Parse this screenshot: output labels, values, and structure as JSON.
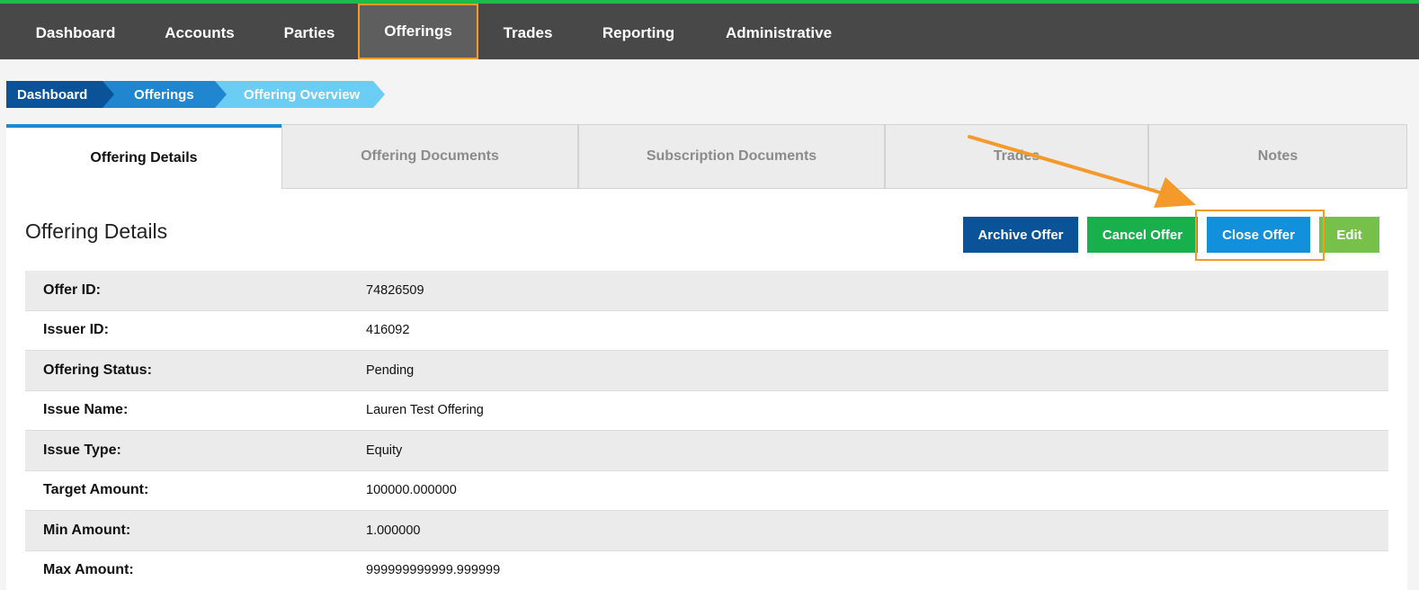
{
  "nav": {
    "items": [
      "Dashboard",
      "Accounts",
      "Parties",
      "Offerings",
      "Trades",
      "Reporting",
      "Administrative"
    ],
    "active": "Offerings"
  },
  "breadcrumb": [
    "Dashboard",
    "Offerings",
    "Offering Overview"
  ],
  "tabs": [
    "Offering Details",
    "Offering Documents",
    "Subscription Documents",
    "Trades",
    "Notes"
  ],
  "panel": {
    "title": "Offering Details",
    "buttons": {
      "archive": "Archive Offer",
      "cancel": "Cancel Offer",
      "close": "Close Offer",
      "edit": "Edit"
    }
  },
  "details": [
    {
      "label": "Offer ID:",
      "value": "74826509"
    },
    {
      "label": "Issuer ID:",
      "value": "416092"
    },
    {
      "label": "Offering Status:",
      "value": "Pending"
    },
    {
      "label": "Issue Name:",
      "value": "Lauren Test Offering"
    },
    {
      "label": "Issue Type:",
      "value": "Equity"
    },
    {
      "label": "Target Amount:",
      "value": "100000.000000"
    },
    {
      "label": "Min Amount:",
      "value": "1.000000"
    },
    {
      "label": "Max Amount:",
      "value": "999999999999.999999"
    }
  ],
  "colors": {
    "nav_bg": "#484848",
    "accent_green": "#1fba4b",
    "highlight_orange": "#f39a2b",
    "archive_blue": "#0b5398",
    "cancel_green": "#17b04c",
    "close_blue": "#1290dc",
    "edit_green": "#77c04a"
  },
  "icons": {
    "annotation": "arrow-icon"
  }
}
